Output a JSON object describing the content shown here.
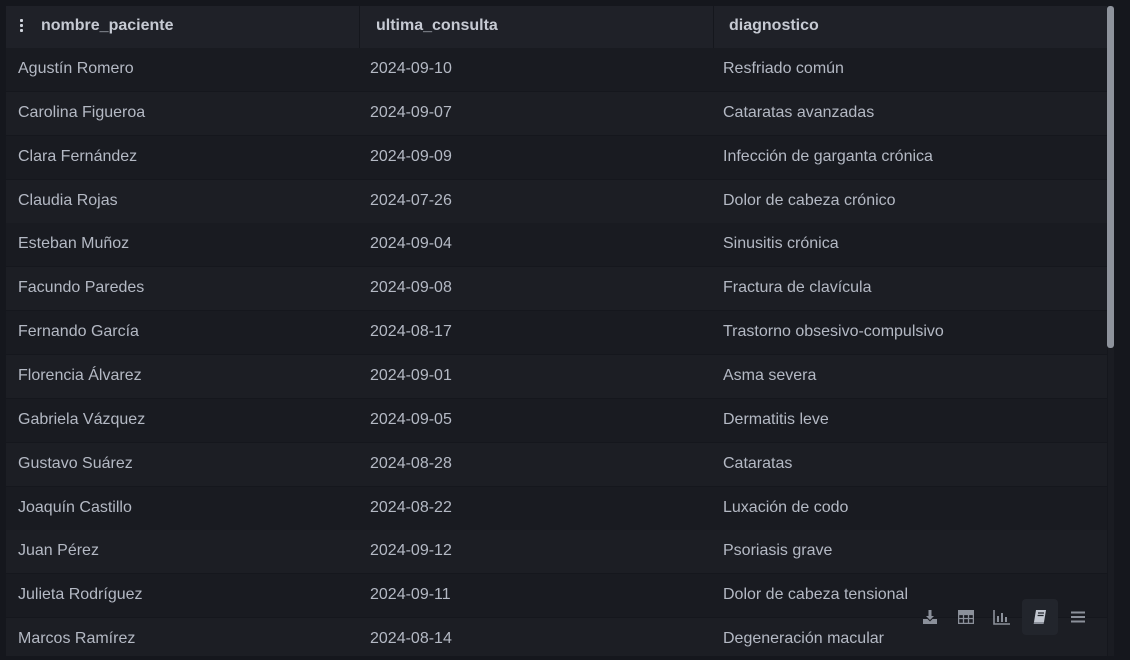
{
  "table": {
    "columns": [
      "nombre_paciente",
      "ultima_consulta",
      "diagnostico"
    ],
    "rows": [
      [
        "Agustín Romero",
        "2024-09-10",
        "Resfriado común"
      ],
      [
        "Carolina Figueroa",
        "2024-09-07",
        "Cataratas avanzadas"
      ],
      [
        "Clara Fernández",
        "2024-09-09",
        "Infección de garganta crónica"
      ],
      [
        "Claudia Rojas",
        "2024-07-26",
        "Dolor de cabeza crónico"
      ],
      [
        "Esteban Muñoz",
        "2024-09-04",
        "Sinusitis crónica"
      ],
      [
        "Facundo Paredes",
        "2024-09-08",
        "Fractura de clavícula"
      ],
      [
        "Fernando García",
        "2024-08-17",
        "Trastorno obsesivo-compulsivo"
      ],
      [
        "Florencia Álvarez",
        "2024-09-01",
        "Asma severa"
      ],
      [
        "Gabriela Vázquez",
        "2024-09-05",
        "Dermatitis leve"
      ],
      [
        "Gustavo Suárez",
        "2024-08-28",
        "Cataratas"
      ],
      [
        "Joaquín Castillo",
        "2024-08-22",
        "Luxación de codo"
      ],
      [
        "Juan Pérez",
        "2024-09-12",
        "Psoriasis grave"
      ],
      [
        "Julieta Rodríguez",
        "2024-09-11",
        "Dolor de cabeza tensional"
      ],
      [
        "Marcos Ramírez",
        "2024-08-14",
        "Degeneración macular"
      ]
    ]
  },
  "toolbar": {
    "icons": [
      "download-icon",
      "table-icon",
      "bar-chart-icon",
      "notebook-icon",
      "menu-icon"
    ],
    "active": "notebook-icon"
  },
  "colors": {
    "background": "#15171d",
    "header": "#1f2128",
    "row_odd": "#191b21",
    "row_even": "#1c1e24",
    "text": "#b4b9c4",
    "scrollbar": "#8e939c"
  }
}
